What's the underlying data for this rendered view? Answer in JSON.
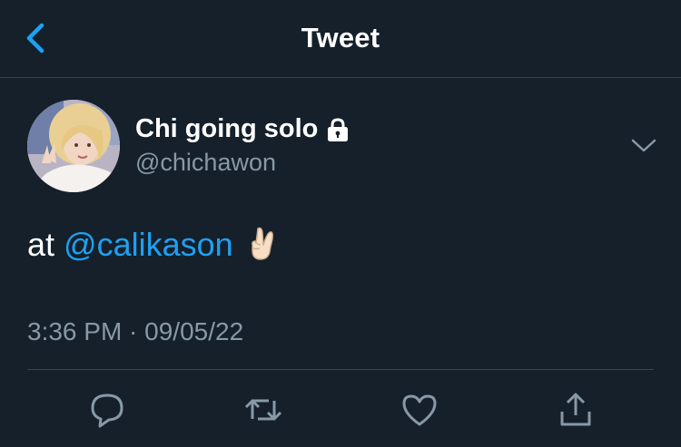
{
  "header": {
    "title": "Tweet",
    "back_icon": "chevron-left-icon"
  },
  "tweet": {
    "author": {
      "display_name": "Chi going solo",
      "handle": "@chichawon",
      "protected_icon": "lock-icon"
    },
    "text_prefix": "at ",
    "mention": "@calikason",
    "emoji": "crossed-fingers-emoji",
    "timestamp": "3:36 PM · 09/05/22"
  },
  "actions": [
    "reply-icon",
    "retweet-icon",
    "like-icon",
    "share-icon"
  ],
  "colors": {
    "background": "#15202b",
    "accent": "#1da1f2",
    "secondary_text": "#8899a6",
    "divider": "#38444d"
  }
}
